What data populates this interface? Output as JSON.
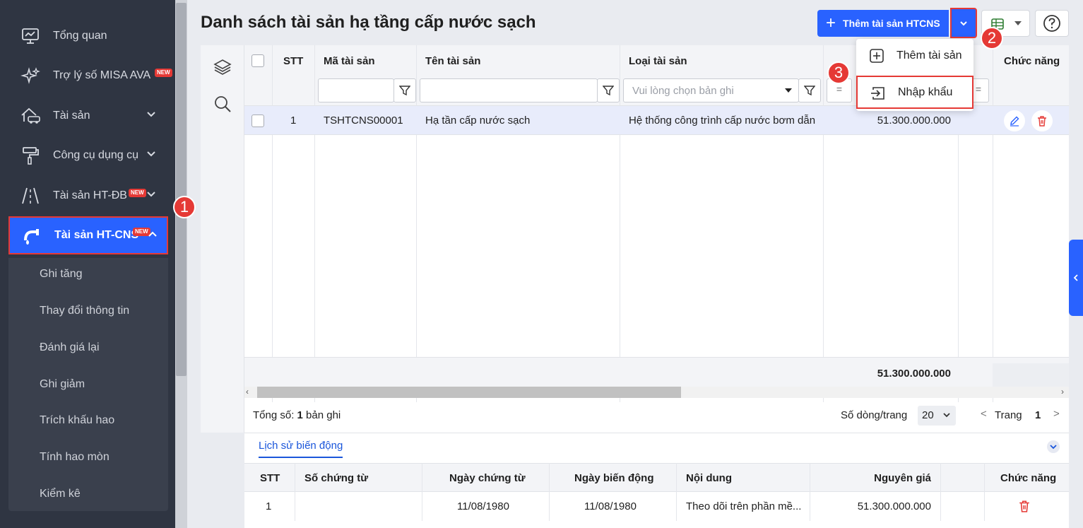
{
  "sidebar": {
    "items": [
      {
        "label": "Tổng quan"
      },
      {
        "label": "Trợ lý số MISA AVA",
        "badge": "NEW"
      },
      {
        "label": "Tài sản"
      },
      {
        "label": "Công cụ dụng cụ"
      },
      {
        "label": "Tài sản HT-ĐB",
        "badge": "NEW"
      },
      {
        "label": "Tài sản HT-CNS",
        "badge": "NEW"
      }
    ],
    "submenu": [
      "Ghi tăng",
      "Thay đổi thông tin",
      "Đánh giá lại",
      "Ghi giảm",
      "Trích khấu hao",
      "Tính hao mòn",
      "Kiểm kê"
    ]
  },
  "callouts": [
    "1",
    "2",
    "3"
  ],
  "page": {
    "title": "Danh sách tài sản hạ tầng cấp nước sạch",
    "add_button": "Thêm tài sản HTCNS"
  },
  "dropdown": {
    "add_asset": "Thêm tài sản",
    "import": "Nhập khẩu"
  },
  "table": {
    "headers": {
      "stt": "STT",
      "code": "Mã tài sản",
      "name": "Tên tài sản",
      "type": "Loại tài sản",
      "actions": "Chức năng"
    },
    "type_filter_placeholder": "Vui lòng chọn bản ghi",
    "eq_symbol": "=",
    "rows": [
      {
        "stt": "1",
        "code": "TSHTCNS00001",
        "name": "Hạ tần cấp nước sạch",
        "type": "Hệ thống công trình cấp nước bơm dẫn",
        "value": "51.300.000.000"
      }
    ],
    "total_value": "51.300.000.000"
  },
  "pager": {
    "total_prefix": "Tổng số: ",
    "total_count": "1",
    "total_suffix": " bản ghi",
    "rows_per_page_label": "Số dòng/trang",
    "rows_per_page": "20",
    "page_label": "Trang",
    "page": "1"
  },
  "history": {
    "tab": "Lịch sử biến động",
    "headers": [
      "STT",
      "Số chứng từ",
      "Ngày chứng từ",
      "Ngày biến động",
      "Nội dung",
      "Nguyên giá",
      "Chức năng"
    ],
    "rows": [
      {
        "stt": "1",
        "doc_no": "",
        "doc_date": "11/08/1980",
        "change_date": "11/08/1980",
        "content": "Theo dõi trên phần mề...",
        "cost": "51.300.000.000"
      }
    ]
  },
  "colors": {
    "primary": "#2962ff",
    "sidebar_bg": "#2f3542",
    "highlight": "#e53935"
  }
}
